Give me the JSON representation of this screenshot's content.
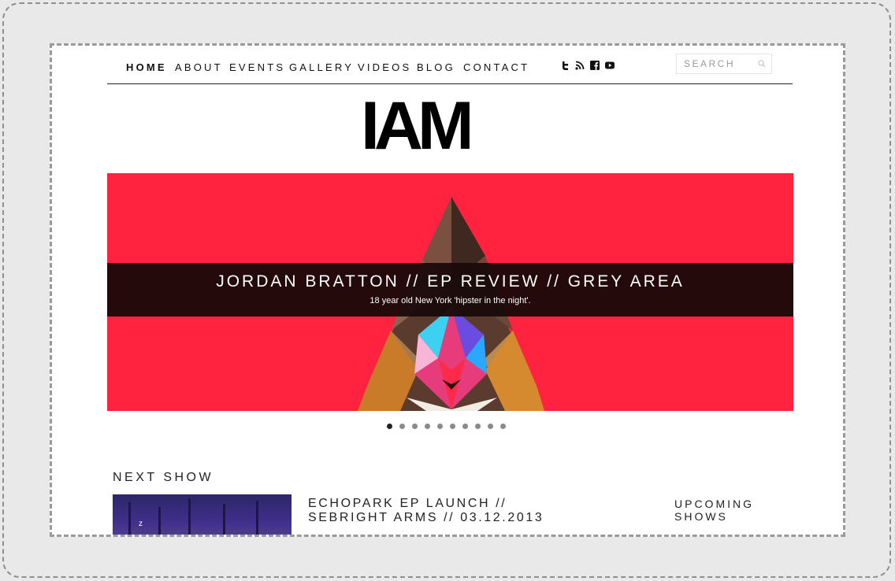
{
  "nav": {
    "items": [
      "HOME",
      "ABOUT",
      "EVENTS",
      "GALLERY",
      "VIDEOS",
      "BLOG",
      "CONTACT"
    ],
    "active": "HOME"
  },
  "social": [
    "twitter-icon",
    "rss-icon",
    "facebook-icon",
    "youtube-icon"
  ],
  "search": {
    "placeholder": "SEARCH"
  },
  "logo": {
    "text": "IAM"
  },
  "hero": {
    "title": "JORDAN BRATTON // EP REVIEW // GREY AREA",
    "subtitle": "18 year old New York 'hipster in the night'.",
    "background": "#ff2340"
  },
  "slider": {
    "count": 10,
    "active": 0
  },
  "next_show": {
    "heading": "NEXT SHOW",
    "thumb_label": "z",
    "title": "ECHOPARK EP LAUNCH // SEBRIGHT ARMS // 03.12.2013"
  },
  "upcoming": {
    "label": "UPCOMING SHOWS"
  }
}
